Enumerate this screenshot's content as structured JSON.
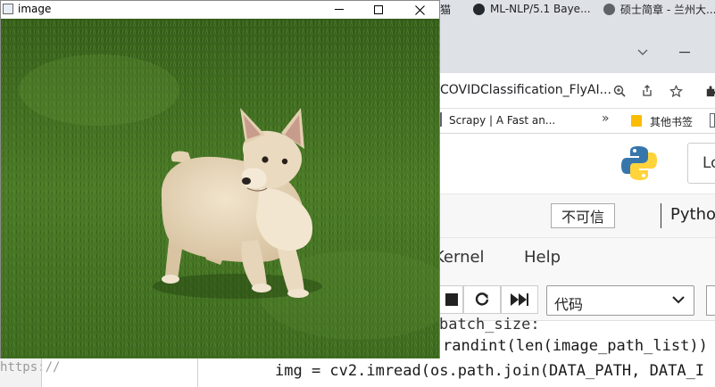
{
  "image_window": {
    "title": "image",
    "app_icon": "window-app-icon",
    "controls": {
      "minimize": "minimize-icon",
      "maximize": "maximize-icon",
      "close": "close-icon"
    },
    "image_subject": "dog-standing-on-grass"
  },
  "browser": {
    "tabs": [
      {
        "label": "猫",
        "icon": "tab-icon"
      },
      {
        "label": "ML-NLP/5.1 Baye...",
        "icon": "github-icon"
      },
      {
        "label": "硕士简章 - 兰州大...",
        "icon": "globe-icon"
      }
    ],
    "address": "COVIDClassification_FlyAI...",
    "bookmarks": [
      {
        "label": "Scrapy | A Fast an..."
      },
      {
        "label": "其他书签"
      }
    ],
    "overflow": "»"
  },
  "jupyter": {
    "trust_label": "不可信",
    "kernel_label": "Python",
    "login_label": "Lo",
    "menu": {
      "kernel": "Kernel",
      "help": "Help"
    },
    "cell_type": {
      "selected": "代码"
    }
  },
  "code": {
    "line1": "batch_size:",
    "line2": "randint(len(image_path_list))",
    "line3": "img = cv2.imread(os.path.join(DATA_PATH, DATA_I",
    "url_fragment": "https://"
  },
  "colors": {
    "jupyter_accent": "#4c8aba",
    "grass": "#3f6b1f",
    "dog_fur": "#e9d8bc"
  }
}
